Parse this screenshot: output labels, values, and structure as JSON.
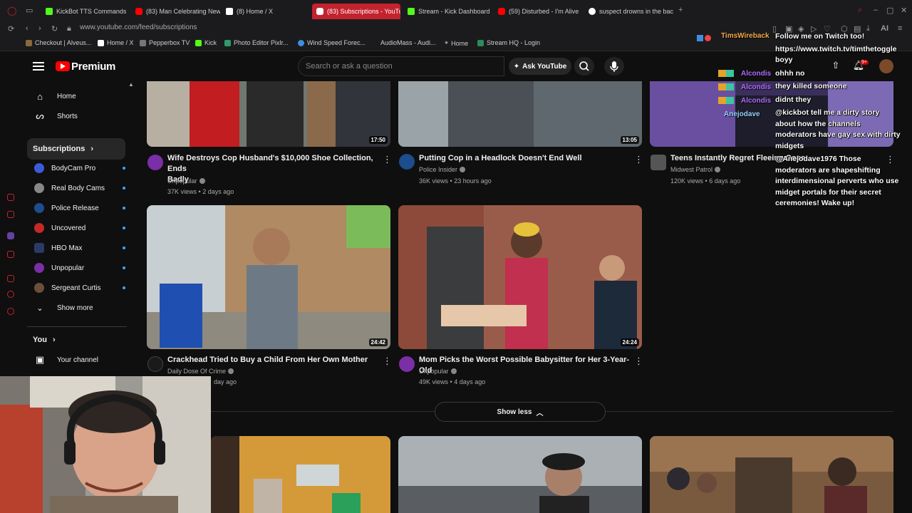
{
  "browser": {
    "tabs": [
      {
        "label": "KickBot TTS Commands",
        "favicon": "kick",
        "active": false
      },
      {
        "label": "(83) Man Celebrating New",
        "favicon": "youtube",
        "active": false
      },
      {
        "label": "(8) Home / X",
        "favicon": "x",
        "active": false
      },
      {
        "label": "(83) Subscriptions - YouTu",
        "favicon": "youtube",
        "active": true
      },
      {
        "label": "Stream - Kick Dashboard",
        "favicon": "kick",
        "active": false
      },
      {
        "label": "(59) Disturbed - I'm Alive",
        "favicon": "youtube",
        "active": false
      },
      {
        "label": "suspect drowns in the back",
        "favicon": "google",
        "active": false
      }
    ],
    "new_tab_label": "+",
    "url": "www.youtube.com/feed/subscriptions",
    "bookmarks": [
      "Checkout | Alveus...",
      "Home / X",
      "Pepperbox TV",
      "Kick",
      "Photo Editor Pixlr...",
      "Wind Speed Forec...",
      "AudioMass - Audi...",
      "Home",
      "Stream HQ - Login"
    ],
    "ai_label": "AI"
  },
  "youtube": {
    "brand": "Premium",
    "search_placeholder": "Search or ask a question",
    "ask_label": "Ask YouTube",
    "notification_count": "9+"
  },
  "sidebar": {
    "home": "Home",
    "shorts": "Shorts",
    "subscriptions_heading": "Subscriptions",
    "subscriptions": [
      {
        "name": "BodyCam Pro",
        "color": "#3b5bdb"
      },
      {
        "name": "Real Body Cams",
        "color": "#888888"
      },
      {
        "name": "Police Release",
        "color": "#1c4d8c"
      },
      {
        "name": "Uncovered",
        "color": "#c62828"
      },
      {
        "name": "HBO Max",
        "color": "#2b3a67"
      },
      {
        "name": "Unpopular",
        "color": "#7b2fa6"
      },
      {
        "name": "Sergeant Curtis",
        "color": "#6b4f3a"
      }
    ],
    "show_more": "Show more",
    "you_heading": "You",
    "your_channel": "Your channel"
  },
  "videos": [
    {
      "title_line1": "Wife Destroys Cop Husband's $10,000 Shoe Collection, Ends",
      "title_line2": "Badly",
      "channel": "Unpopular",
      "views": "37K views",
      "age": "2 days ago",
      "duration": "17:50",
      "channel_color": "#7b2fa6"
    },
    {
      "title_line1": "Putting Cop in a Headlock Doesn't End Well",
      "title_line2": "",
      "channel": "Police Insider",
      "views": "36K views",
      "age": "23 hours ago",
      "duration": "13:05",
      "channel_color": "#1c4d8c"
    },
    {
      "title_line1": "Teens Instantly Regret Fleeing Cops",
      "title_line2": "",
      "channel": "Midwest Patrol",
      "views": "120K views",
      "age": "6 days ago",
      "duration": "",
      "channel_color": "#555555"
    },
    {
      "title_line1": "Crackhead Tried to Buy a Child From Her Own Mother",
      "title_line2": "",
      "channel": "Daily Dose Of Crime",
      "views": "",
      "age": "day ago",
      "duration": "24:42",
      "channel_color": "#1a1a1a"
    },
    {
      "title_line1": "Mom Picks the Worst Possible Babysitter for Her 3-Year-Old",
      "title_line2": "",
      "channel": "Unpopular",
      "views": "49K views",
      "age": "4 days ago",
      "duration": "24:24",
      "channel_color": "#7b2fa6"
    }
  ],
  "show_less": "Show less",
  "chat": {
    "username_header": "TimsWireback",
    "side_names": [
      "Alcondis",
      "Alcondis",
      "Alcondis",
      "Anejodave"
    ],
    "lines": [
      "Follow me on Twitch too!",
      "https://www.twitch.tv/timthetoggle",
      "boyy",
      "ohhh no",
      "they killed someone",
      "didnt they",
      "@kickbot tell me a dirty story",
      "about how the channels",
      "moderators have gay sex with dirty",
      "midgets",
      "@Anejodave1976 Those",
      "moderators are shapeshifting",
      "interdimensional perverts who use",
      "midget portals for their secret",
      "ceremonies! Wake up!"
    ]
  }
}
